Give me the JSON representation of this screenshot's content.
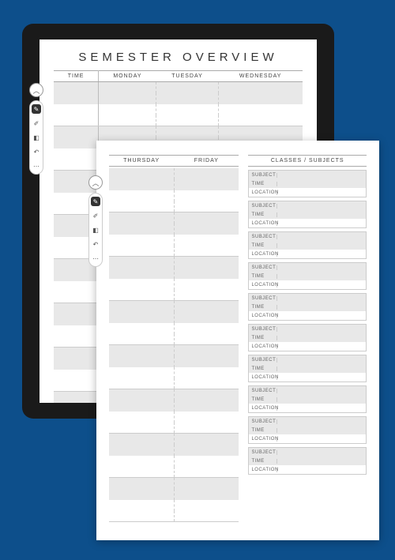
{
  "page1": {
    "title": "SEMESTER OVERVIEW",
    "columns": [
      "TIME",
      "MONDAY",
      "TUESDAY",
      "WEDNESDAY"
    ]
  },
  "page2": {
    "left_columns": [
      "THURSDAY",
      "FRIDAY"
    ],
    "right_title": "CLASSES / SUBJECTS",
    "card_labels": {
      "subject": "SUBJECT",
      "time": "TIME",
      "location": "LOCATION"
    }
  },
  "toolbar": {
    "collapse": "︿",
    "items": [
      "pen",
      "highlighter",
      "eraser",
      "undo",
      "more"
    ]
  }
}
